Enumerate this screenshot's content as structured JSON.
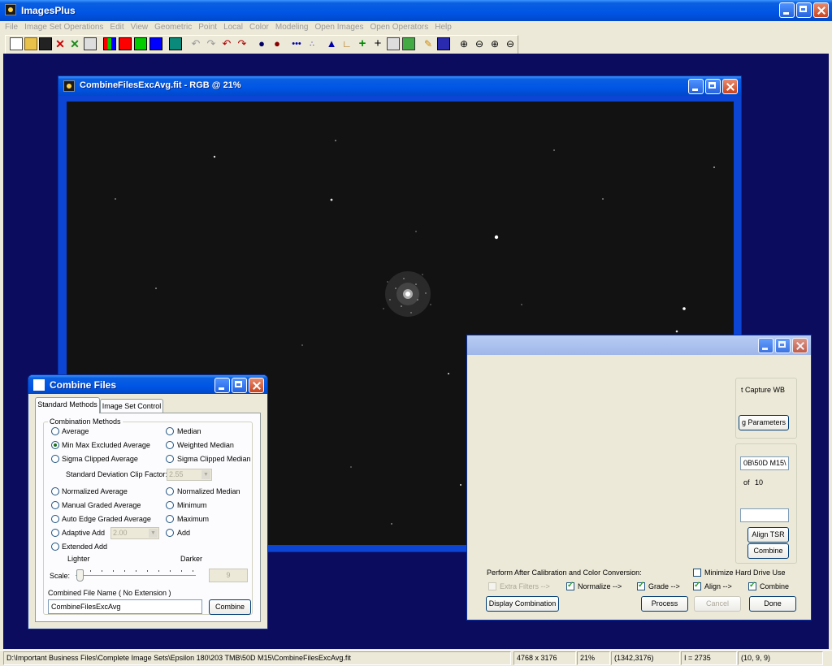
{
  "app": {
    "title": "ImagesPlus"
  },
  "menu": [
    "File",
    "Image Set Operations",
    "Edit",
    "View",
    "Geometric",
    "Point",
    "Local",
    "Color",
    "Modeling",
    "Open Images",
    "Open Operators",
    "Help"
  ],
  "image_window": {
    "title": "CombineFilesExcAvg.fit - RGB @ 21%"
  },
  "process_window": {
    "capture_wb": "t Capture WB",
    "params_button": "g Parameters",
    "path_field": "0B\\50D M15\\",
    "of_label": "of",
    "of_count": "10",
    "align_tsr_button": "Align TSR",
    "combine_button": "Combine",
    "perform_label": "Perform After Calibration and Color Conversion:",
    "minimize_label": "Minimize Hard Drive Use",
    "extra_filters_label": "Extra Filters -->",
    "normalize_label": "Normalize -->",
    "grade_label": "Grade -->",
    "align_label": "Align -->",
    "combine_label": "Combine",
    "display_button": "Display Combination",
    "process_button": "Process",
    "cancel_button": "Cancel",
    "done_button": "Done"
  },
  "combine_dialog": {
    "title": "Combine Files",
    "tabs": [
      "Standard Methods",
      "Image Set Control"
    ],
    "group_label": "Combination Methods",
    "methods_left": [
      "Average",
      "Min Max Excluded Average",
      "Sigma Clipped Average"
    ],
    "methods_right": [
      "Median",
      "Weighted Median",
      "Sigma Clipped Median"
    ],
    "std_dev_label": "Standard Deviation Clip Factor:",
    "std_dev_value": "2.55",
    "methods_left2": [
      "Normalized Average",
      "Manual Graded Average",
      "Auto Edge Graded Average",
      "Adaptive Add",
      "Extended Add"
    ],
    "methods_right2": [
      "Normalized Median",
      "Minimum",
      "Maximum",
      "Add"
    ],
    "adaptive_value": "2.00",
    "selected_method": "Min Max Excluded Average",
    "lighter_label": "Lighter",
    "darker_label": "Darker",
    "scale_label": "Scale:",
    "scale_value": "9",
    "filename_label": "Combined File Name (  No Extension  )",
    "filename_value": "CombineFilesExcAvg",
    "combine_button": "Combine"
  },
  "status": {
    "path": "D:\\Important Business Files\\Complete Image Sets\\Epsilon 180\\203 TMB\\50D M15\\CombineFilesExcAvg.fit",
    "dimensions": "4768 x 3176",
    "zoom": "21%",
    "coords": "(1342,3176)",
    "intensity": "I = 2735",
    "rgb": "(10, 9, 9)"
  }
}
